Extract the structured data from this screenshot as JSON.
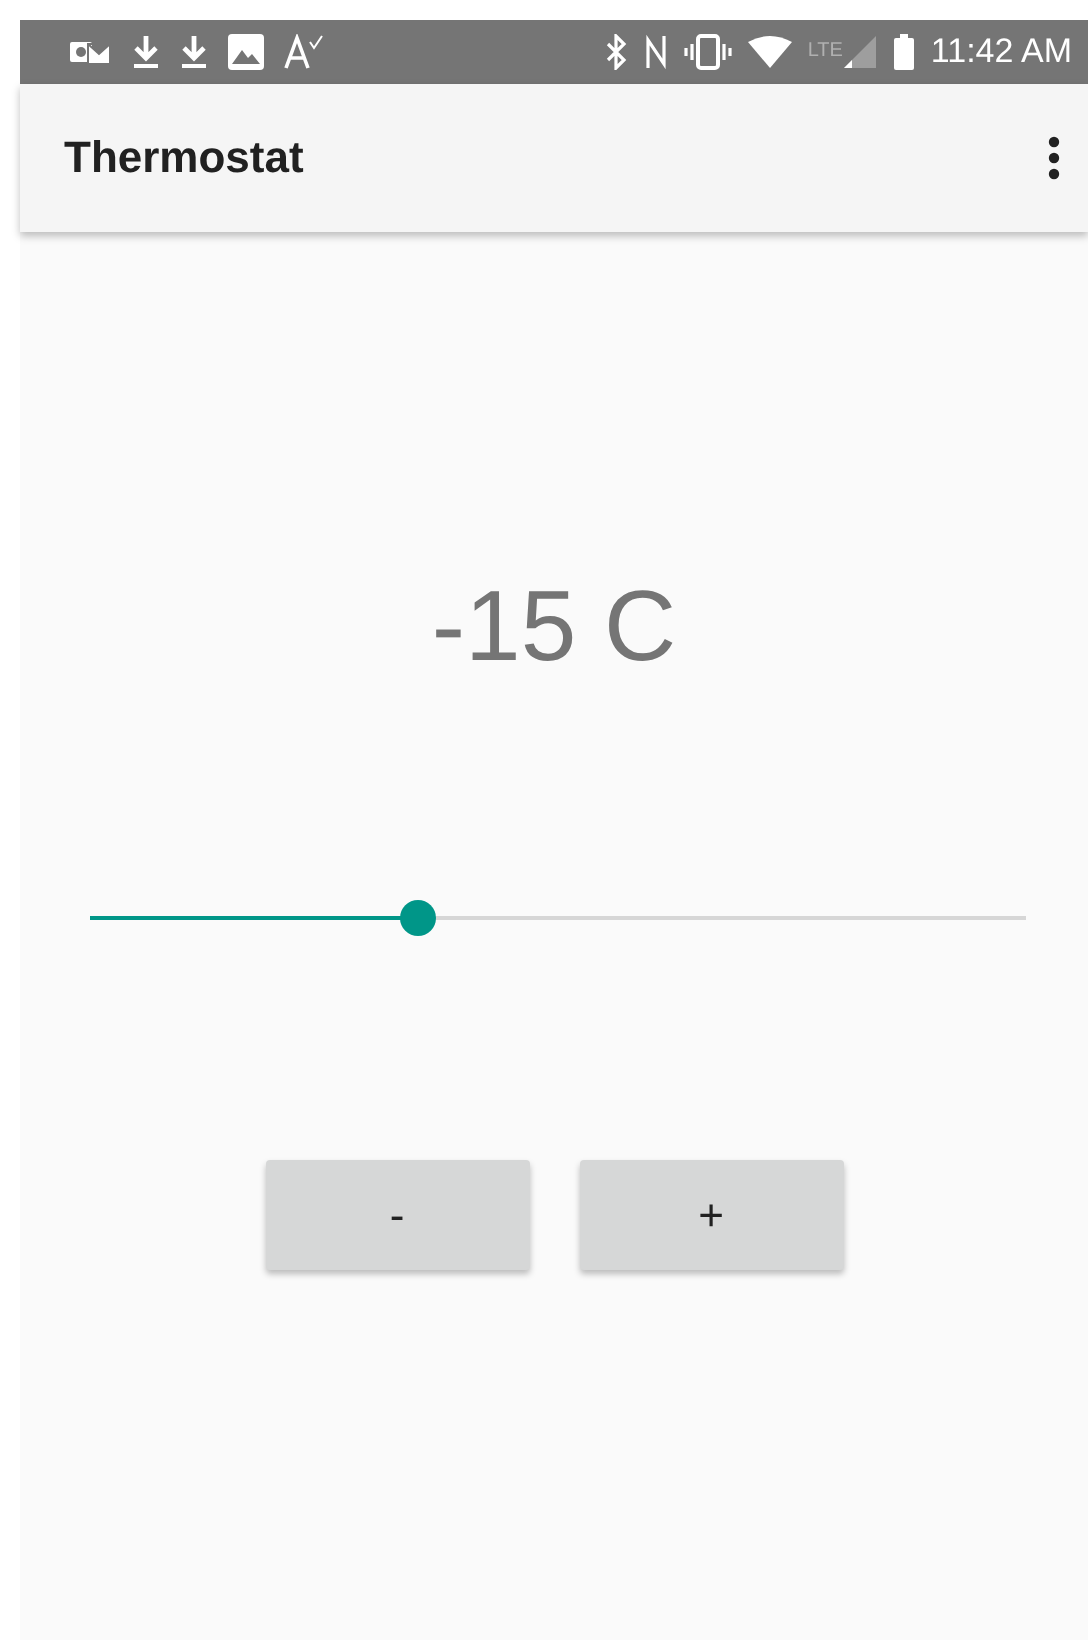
{
  "status_bar": {
    "network": "LTE",
    "time": "11:42 AM"
  },
  "app_bar": {
    "title": "Thermostat"
  },
  "temperature": {
    "reading": "-15 C"
  },
  "slider": {
    "level": 0.35
  },
  "buttons": [
    {
      "label": "-"
    },
    {
      "label": "+"
    }
  ]
}
